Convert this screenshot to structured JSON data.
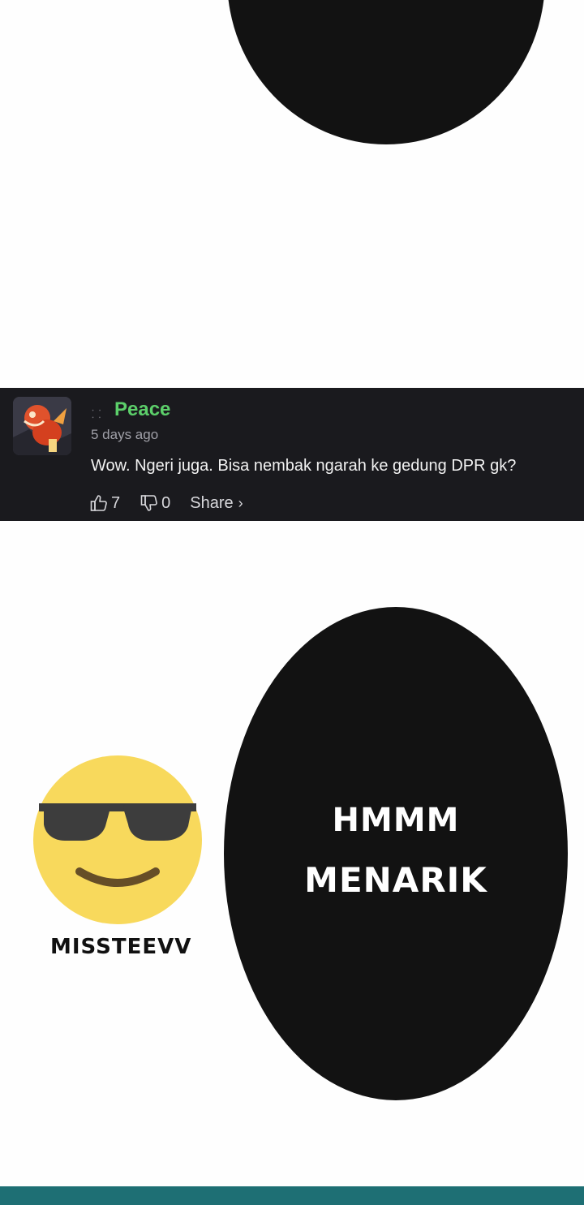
{
  "comment": {
    "username": "Peace",
    "time": "5 days ago",
    "text": "Wow. Ngeri juga. Bisa nembak ngarah ke gedung DPR gk?",
    "likes": "7",
    "dislikes": "0",
    "share_label": "Share",
    "share_chevron": "›",
    "meta_icon": "user-icon",
    "username_color": "#5ccf6a"
  },
  "panel": {
    "emoji_caption": "MISSTEEVV",
    "bubble_line1": "HMMM",
    "bubble_line2": "MENARIK",
    "emoji_icon": "sunglasses-emoji-icon"
  }
}
